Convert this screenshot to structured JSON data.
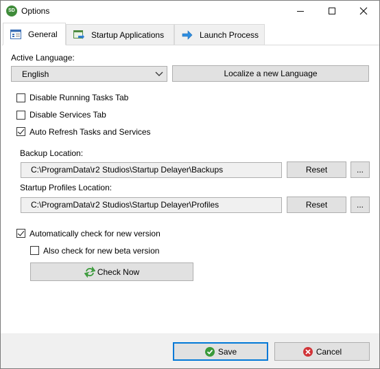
{
  "window": {
    "title": "Options",
    "app_icon_text": "SD"
  },
  "tabs": [
    {
      "label": "General",
      "active": true
    },
    {
      "label": "Startup Applications",
      "active": false
    },
    {
      "label": "Launch Process",
      "active": false
    }
  ],
  "general": {
    "active_language_label": "Active Language:",
    "language_value": "English",
    "localize_button": "Localize a new Language",
    "disable_running_tasks": {
      "label": "Disable Running Tasks Tab",
      "checked": false
    },
    "disable_services": {
      "label": "Disable Services Tab",
      "checked": false
    },
    "auto_refresh": {
      "label": "Auto Refresh Tasks and Services",
      "checked": true
    },
    "backup_location_label": "Backup Location:",
    "backup_location_value": "C:\\ProgramData\\r2 Studios\\Startup Delayer\\Backups",
    "profiles_location_label": "Startup Profiles Location:",
    "profiles_location_value": "C:\\ProgramData\\r2 Studios\\Startup Delayer\\Profiles",
    "reset_label": "Reset",
    "browse_label": "...",
    "auto_check_version": {
      "label": "Automatically check for new version",
      "checked": true
    },
    "beta_version": {
      "label": "Also check for new beta version",
      "checked": false
    },
    "check_now_button": "Check Now"
  },
  "footer": {
    "save_button": "Save",
    "cancel_button": "Cancel"
  },
  "colors": {
    "accent": "#0078d7",
    "refresh_icon": "#3a9a3a",
    "save_icon": "#3a9a3a",
    "cancel_icon": "#d13438"
  }
}
